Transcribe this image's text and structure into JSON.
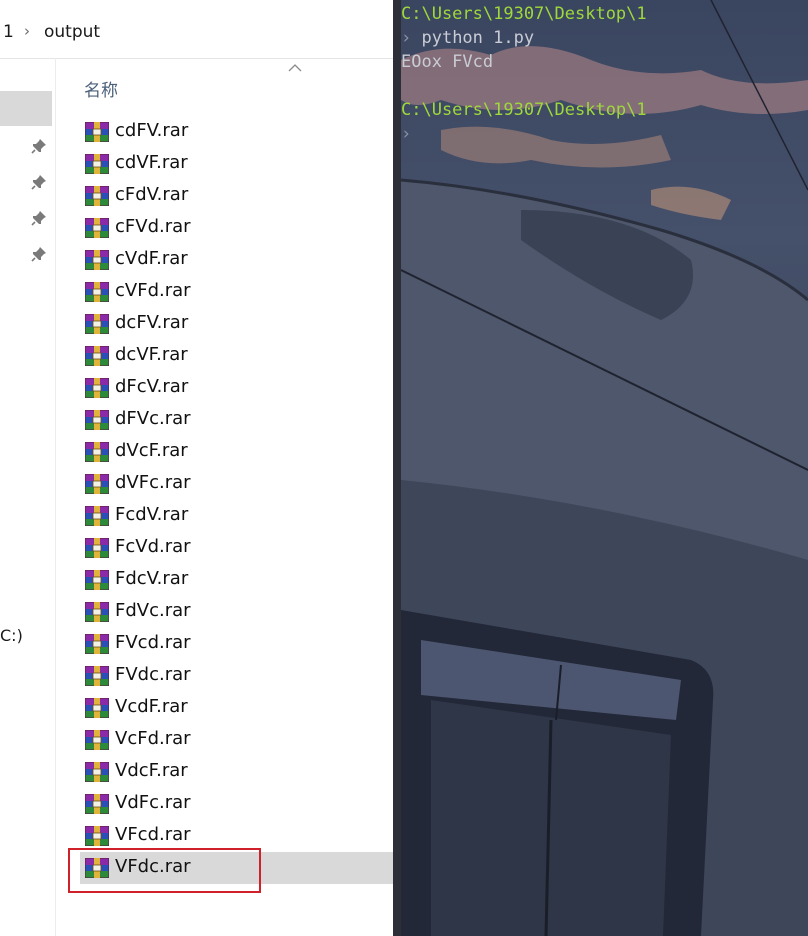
{
  "explorer": {
    "breadcrumb": {
      "segment1": "1",
      "separator": "›",
      "segment2": "output"
    },
    "column_header": "名称",
    "drive_label": "C:)",
    "files": [
      "cdFV.rar",
      "cdVF.rar",
      "cFdV.rar",
      "cFVd.rar",
      "cVdF.rar",
      "cVFd.rar",
      "dcFV.rar",
      "dcVF.rar",
      "dFcV.rar",
      "dFVc.rar",
      "dVcF.rar",
      "dVFc.rar",
      "FcdV.rar",
      "FcVd.rar",
      "FdcV.rar",
      "FdVc.rar",
      "FVcd.rar",
      "FVdc.rar",
      "VcdF.rar",
      "VcFd.rar",
      "VdcF.rar",
      "VdFc.rar",
      "VFcd.rar",
      "VFdc.rar"
    ],
    "selected_file": "VFdc.rar",
    "highlight_color": "#d0202a"
  },
  "terminal": {
    "prompt1": "C:\\Users\\19307\\Desktop\\1",
    "command_prefix": "› ",
    "command": "python 1.py",
    "output": "EOox FVcd",
    "prompt2": "C:\\Users\\19307\\Desktop\\1",
    "cursor_prefix": "›",
    "prompt_color": "#9fd83a"
  }
}
